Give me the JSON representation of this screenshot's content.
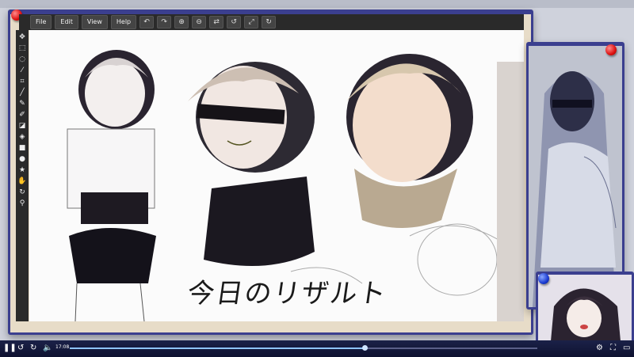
{
  "menu": {
    "file": "File",
    "edit": "Edit",
    "view": "View",
    "help": "Help"
  },
  "toolbar_icons": [
    "undo-icon",
    "redo-icon",
    "zoom-in-icon",
    "zoom-out-icon",
    "swap-icon",
    "rotate-left-icon",
    "fullscreen-icon",
    "refresh-icon"
  ],
  "tools": [
    "move",
    "select",
    "lasso",
    "magic-wand",
    "crop",
    "eyedropper",
    "pen",
    "brush",
    "eraser",
    "bucket",
    "rectangle",
    "ellipse",
    "star",
    "hand",
    "rotate",
    "zoom"
  ],
  "canvas": {
    "caption": "今日のリザルト"
  },
  "player": {
    "time": "17:08",
    "progress": 0.63
  },
  "colors": {
    "window_border": "#3b3f8f",
    "frame": "#e7dcc8",
    "player_bg": "#1b2148",
    "progress": "#8ec3ff"
  }
}
